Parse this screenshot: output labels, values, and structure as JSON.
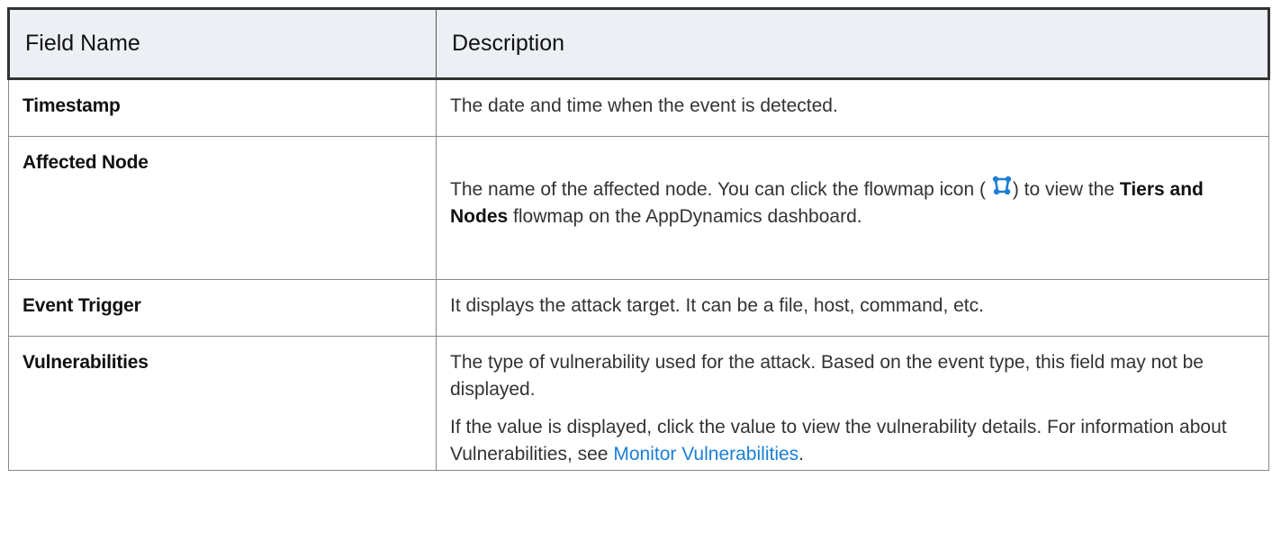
{
  "table": {
    "headers": {
      "field_name": "Field Name",
      "description": "Description"
    },
    "rows": [
      {
        "field": "Timestamp",
        "description": "The date and time when the event is detected."
      },
      {
        "field": "Affected Node",
        "description_part1": "The name of the affected node. You can click the flowmap icon (",
        "description_part2": ") to view the",
        "description_bold": "Tiers and Nodes",
        "description_part3": "flowmap on the AppDynamics dashboard.",
        "icon": "flowmap-icon"
      },
      {
        "field": "Event Trigger",
        "description": "It displays the attack target. It can be a file, host, command, etc."
      },
      {
        "field": "Vulnerabilities",
        "description_para1": "The type of vulnerability used for the attack. Based on the event type, this field may not be displayed.",
        "description_para2": "If the value is displayed, click the value to view the vulnerability details. For information about Vulnerabilities, see",
        "link_text": "Monitor Vulnerabilities",
        "trailing": "."
      }
    ]
  },
  "colors": {
    "header_background": "#eceff3",
    "link": "#1b7fd6",
    "icon": "#1b7fd6"
  }
}
